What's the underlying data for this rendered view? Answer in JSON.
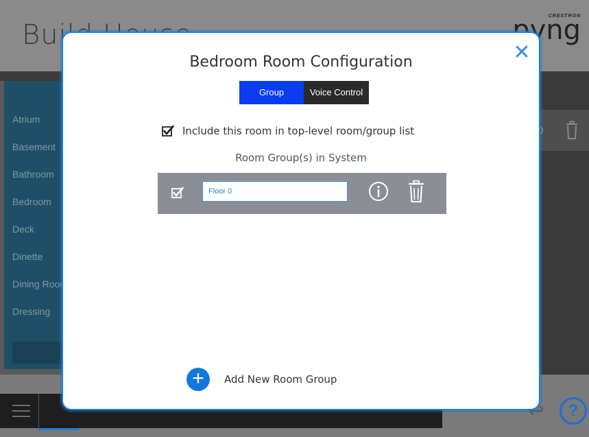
{
  "background": {
    "app_title": "Build House",
    "brand_small": "CRESTRON",
    "brand_big": "pyng",
    "sidebar_items": [
      "Atrium",
      "Basement",
      "Bathroom",
      "Bedroom",
      "Deck",
      "Dinette",
      "Dining Room",
      "Dressing"
    ]
  },
  "modal": {
    "title": "Bedroom Room Configuration",
    "close_glyph": "✕",
    "tabs": [
      {
        "label": "Group",
        "active": true
      },
      {
        "label": "Voice Control",
        "active": false
      }
    ],
    "include_label": "Include this room in top-level room/group list",
    "include_checked": true,
    "groups_heading": "Room Group(s) in System",
    "groups": [
      {
        "name": "Floor 0",
        "checked": true
      }
    ],
    "add_label": "Add New Room Group",
    "add_glyph": "+"
  },
  "bottom": {
    "help_glyph": "?"
  },
  "colors": {
    "accent": "#1277e0",
    "tab_active": "#0a3cf0",
    "tab_inactive": "#2a2a2a",
    "group_row": "#8b8f95"
  },
  "icons": [
    "close-icon",
    "checkbox-checked-icon",
    "info-icon",
    "trash-icon",
    "plus-icon",
    "gear-icon",
    "help-icon",
    "back-icon"
  ]
}
